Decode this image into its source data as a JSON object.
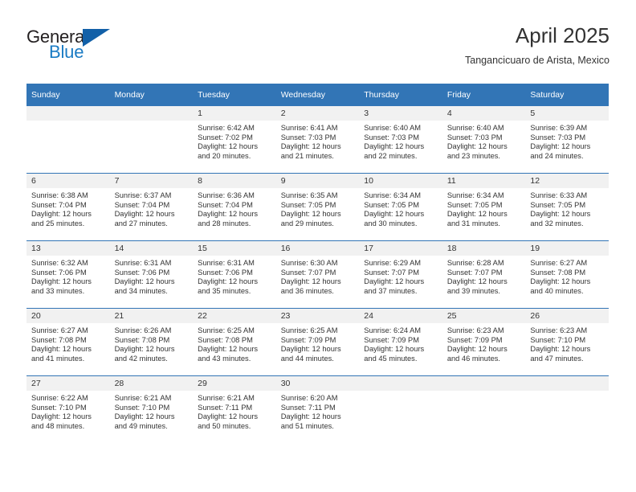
{
  "brand": {
    "name_part1": "General",
    "name_part2": "Blue"
  },
  "header": {
    "title": "April 2025",
    "subtitle": "Tangancicuaro de Arista, Mexico"
  },
  "colors": {
    "header_blue": "#3275b6",
    "brand_blue": "#1a7bc4",
    "triangle_blue": "#1260a8",
    "daynum_band": "#f1f1f1",
    "text": "#333333"
  },
  "weekday_headers": [
    "Sunday",
    "Monday",
    "Tuesday",
    "Wednesday",
    "Thursday",
    "Friday",
    "Saturday"
  ],
  "weeks": [
    [
      {
        "day": "",
        "sunrise": "",
        "sunset": "",
        "daylight1": "",
        "daylight2": ""
      },
      {
        "day": "",
        "sunrise": "",
        "sunset": "",
        "daylight1": "",
        "daylight2": ""
      },
      {
        "day": "1",
        "sunrise": "Sunrise: 6:42 AM",
        "sunset": "Sunset: 7:02 PM",
        "daylight1": "Daylight: 12 hours",
        "daylight2": "and 20 minutes."
      },
      {
        "day": "2",
        "sunrise": "Sunrise: 6:41 AM",
        "sunset": "Sunset: 7:03 PM",
        "daylight1": "Daylight: 12 hours",
        "daylight2": "and 21 minutes."
      },
      {
        "day": "3",
        "sunrise": "Sunrise: 6:40 AM",
        "sunset": "Sunset: 7:03 PM",
        "daylight1": "Daylight: 12 hours",
        "daylight2": "and 22 minutes."
      },
      {
        "day": "4",
        "sunrise": "Sunrise: 6:40 AM",
        "sunset": "Sunset: 7:03 PM",
        "daylight1": "Daylight: 12 hours",
        "daylight2": "and 23 minutes."
      },
      {
        "day": "5",
        "sunrise": "Sunrise: 6:39 AM",
        "sunset": "Sunset: 7:03 PM",
        "daylight1": "Daylight: 12 hours",
        "daylight2": "and 24 minutes."
      }
    ],
    [
      {
        "day": "6",
        "sunrise": "Sunrise: 6:38 AM",
        "sunset": "Sunset: 7:04 PM",
        "daylight1": "Daylight: 12 hours",
        "daylight2": "and 25 minutes."
      },
      {
        "day": "7",
        "sunrise": "Sunrise: 6:37 AM",
        "sunset": "Sunset: 7:04 PM",
        "daylight1": "Daylight: 12 hours",
        "daylight2": "and 27 minutes."
      },
      {
        "day": "8",
        "sunrise": "Sunrise: 6:36 AM",
        "sunset": "Sunset: 7:04 PM",
        "daylight1": "Daylight: 12 hours",
        "daylight2": "and 28 minutes."
      },
      {
        "day": "9",
        "sunrise": "Sunrise: 6:35 AM",
        "sunset": "Sunset: 7:05 PM",
        "daylight1": "Daylight: 12 hours",
        "daylight2": "and 29 minutes."
      },
      {
        "day": "10",
        "sunrise": "Sunrise: 6:34 AM",
        "sunset": "Sunset: 7:05 PM",
        "daylight1": "Daylight: 12 hours",
        "daylight2": "and 30 minutes."
      },
      {
        "day": "11",
        "sunrise": "Sunrise: 6:34 AM",
        "sunset": "Sunset: 7:05 PM",
        "daylight1": "Daylight: 12 hours",
        "daylight2": "and 31 minutes."
      },
      {
        "day": "12",
        "sunrise": "Sunrise: 6:33 AM",
        "sunset": "Sunset: 7:05 PM",
        "daylight1": "Daylight: 12 hours",
        "daylight2": "and 32 minutes."
      }
    ],
    [
      {
        "day": "13",
        "sunrise": "Sunrise: 6:32 AM",
        "sunset": "Sunset: 7:06 PM",
        "daylight1": "Daylight: 12 hours",
        "daylight2": "and 33 minutes."
      },
      {
        "day": "14",
        "sunrise": "Sunrise: 6:31 AM",
        "sunset": "Sunset: 7:06 PM",
        "daylight1": "Daylight: 12 hours",
        "daylight2": "and 34 minutes."
      },
      {
        "day": "15",
        "sunrise": "Sunrise: 6:31 AM",
        "sunset": "Sunset: 7:06 PM",
        "daylight1": "Daylight: 12 hours",
        "daylight2": "and 35 minutes."
      },
      {
        "day": "16",
        "sunrise": "Sunrise: 6:30 AM",
        "sunset": "Sunset: 7:07 PM",
        "daylight1": "Daylight: 12 hours",
        "daylight2": "and 36 minutes."
      },
      {
        "day": "17",
        "sunrise": "Sunrise: 6:29 AM",
        "sunset": "Sunset: 7:07 PM",
        "daylight1": "Daylight: 12 hours",
        "daylight2": "and 37 minutes."
      },
      {
        "day": "18",
        "sunrise": "Sunrise: 6:28 AM",
        "sunset": "Sunset: 7:07 PM",
        "daylight1": "Daylight: 12 hours",
        "daylight2": "and 39 minutes."
      },
      {
        "day": "19",
        "sunrise": "Sunrise: 6:27 AM",
        "sunset": "Sunset: 7:08 PM",
        "daylight1": "Daylight: 12 hours",
        "daylight2": "and 40 minutes."
      }
    ],
    [
      {
        "day": "20",
        "sunrise": "Sunrise: 6:27 AM",
        "sunset": "Sunset: 7:08 PM",
        "daylight1": "Daylight: 12 hours",
        "daylight2": "and 41 minutes."
      },
      {
        "day": "21",
        "sunrise": "Sunrise: 6:26 AM",
        "sunset": "Sunset: 7:08 PM",
        "daylight1": "Daylight: 12 hours",
        "daylight2": "and 42 minutes."
      },
      {
        "day": "22",
        "sunrise": "Sunrise: 6:25 AM",
        "sunset": "Sunset: 7:08 PM",
        "daylight1": "Daylight: 12 hours",
        "daylight2": "and 43 minutes."
      },
      {
        "day": "23",
        "sunrise": "Sunrise: 6:25 AM",
        "sunset": "Sunset: 7:09 PM",
        "daylight1": "Daylight: 12 hours",
        "daylight2": "and 44 minutes."
      },
      {
        "day": "24",
        "sunrise": "Sunrise: 6:24 AM",
        "sunset": "Sunset: 7:09 PM",
        "daylight1": "Daylight: 12 hours",
        "daylight2": "and 45 minutes."
      },
      {
        "day": "25",
        "sunrise": "Sunrise: 6:23 AM",
        "sunset": "Sunset: 7:09 PM",
        "daylight1": "Daylight: 12 hours",
        "daylight2": "and 46 minutes."
      },
      {
        "day": "26",
        "sunrise": "Sunrise: 6:23 AM",
        "sunset": "Sunset: 7:10 PM",
        "daylight1": "Daylight: 12 hours",
        "daylight2": "and 47 minutes."
      }
    ],
    [
      {
        "day": "27",
        "sunrise": "Sunrise: 6:22 AM",
        "sunset": "Sunset: 7:10 PM",
        "daylight1": "Daylight: 12 hours",
        "daylight2": "and 48 minutes."
      },
      {
        "day": "28",
        "sunrise": "Sunrise: 6:21 AM",
        "sunset": "Sunset: 7:10 PM",
        "daylight1": "Daylight: 12 hours",
        "daylight2": "and 49 minutes."
      },
      {
        "day": "29",
        "sunrise": "Sunrise: 6:21 AM",
        "sunset": "Sunset: 7:11 PM",
        "daylight1": "Daylight: 12 hours",
        "daylight2": "and 50 minutes."
      },
      {
        "day": "30",
        "sunrise": "Sunrise: 6:20 AM",
        "sunset": "Sunset: 7:11 PM",
        "daylight1": "Daylight: 12 hours",
        "daylight2": "and 51 minutes."
      },
      {
        "day": "",
        "sunrise": "",
        "sunset": "",
        "daylight1": "",
        "daylight2": ""
      },
      {
        "day": "",
        "sunrise": "",
        "sunset": "",
        "daylight1": "",
        "daylight2": ""
      },
      {
        "day": "",
        "sunrise": "",
        "sunset": "",
        "daylight1": "",
        "daylight2": ""
      }
    ]
  ]
}
